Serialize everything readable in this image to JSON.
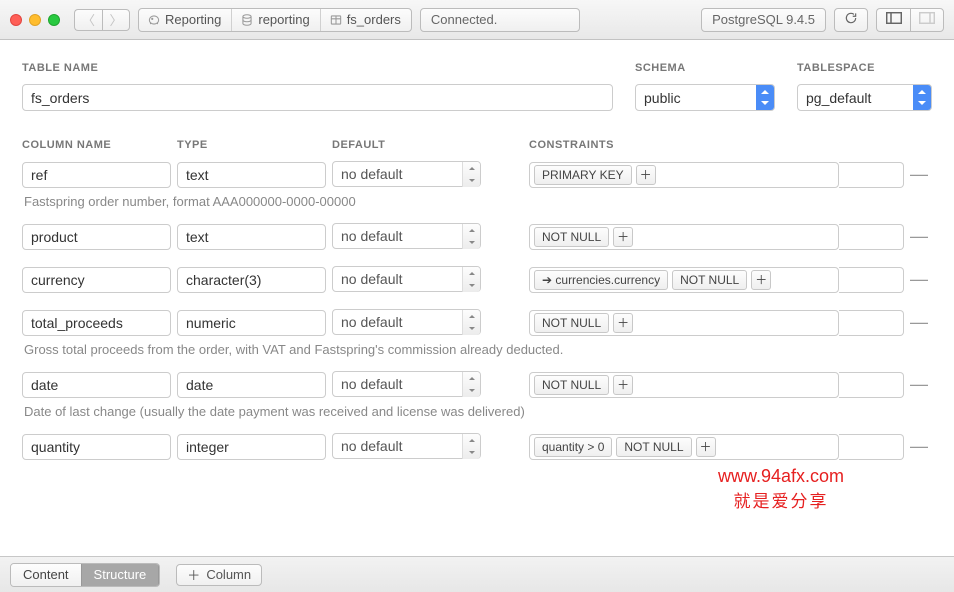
{
  "toolbar": {
    "breadcrumb": [
      {
        "icon": "elephant",
        "label": "Reporting"
      },
      {
        "icon": "database",
        "label": "reporting"
      },
      {
        "icon": "table",
        "label": "fs_orders"
      }
    ],
    "status": "Connected.",
    "version": "PostgreSQL 9.4.5"
  },
  "headers": {
    "table_name": "TABLE NAME",
    "schema": "SCHEMA",
    "tablespace": "TABLESPACE",
    "column_name": "COLUMN NAME",
    "type": "TYPE",
    "default": "DEFAULT",
    "constraints": "CONSTRAINTS"
  },
  "table": {
    "name": "fs_orders",
    "schema": "public",
    "tablespace": "pg_default"
  },
  "columns": [
    {
      "name": "ref",
      "type": "text",
      "default": "no default",
      "constraints": [
        "PRIMARY KEY"
      ],
      "comment": "Fastspring order number, format AAA000000-0000-00000"
    },
    {
      "name": "product",
      "type": "text",
      "default": "no default",
      "constraints": [
        "NOT NULL"
      ],
      "comment": ""
    },
    {
      "name": "currency",
      "type": "character(3)",
      "default": "no default",
      "constraints": [
        "➔ currencies.currency",
        "NOT NULL"
      ],
      "comment": ""
    },
    {
      "name": "total_proceeds",
      "type": "numeric",
      "default": "no default",
      "constraints": [
        "NOT NULL"
      ],
      "comment": "Gross total proceeds from the order, with VAT and Fastspring's commission already deducted."
    },
    {
      "name": "date",
      "type": "date",
      "default": "no default",
      "constraints": [
        "NOT NULL"
      ],
      "comment": "Date of last change (usually the date payment was received and license was delivered)"
    },
    {
      "name": "quantity",
      "type": "integer",
      "default": "no default",
      "constraints": [
        "quantity > 0",
        "NOT NULL"
      ],
      "comment": ""
    }
  ],
  "bottom": {
    "content": "Content",
    "structure": "Structure",
    "add_column": "Column"
  },
  "watermark": {
    "line1": "www.94afx.com",
    "line2": "就是爱分享"
  }
}
